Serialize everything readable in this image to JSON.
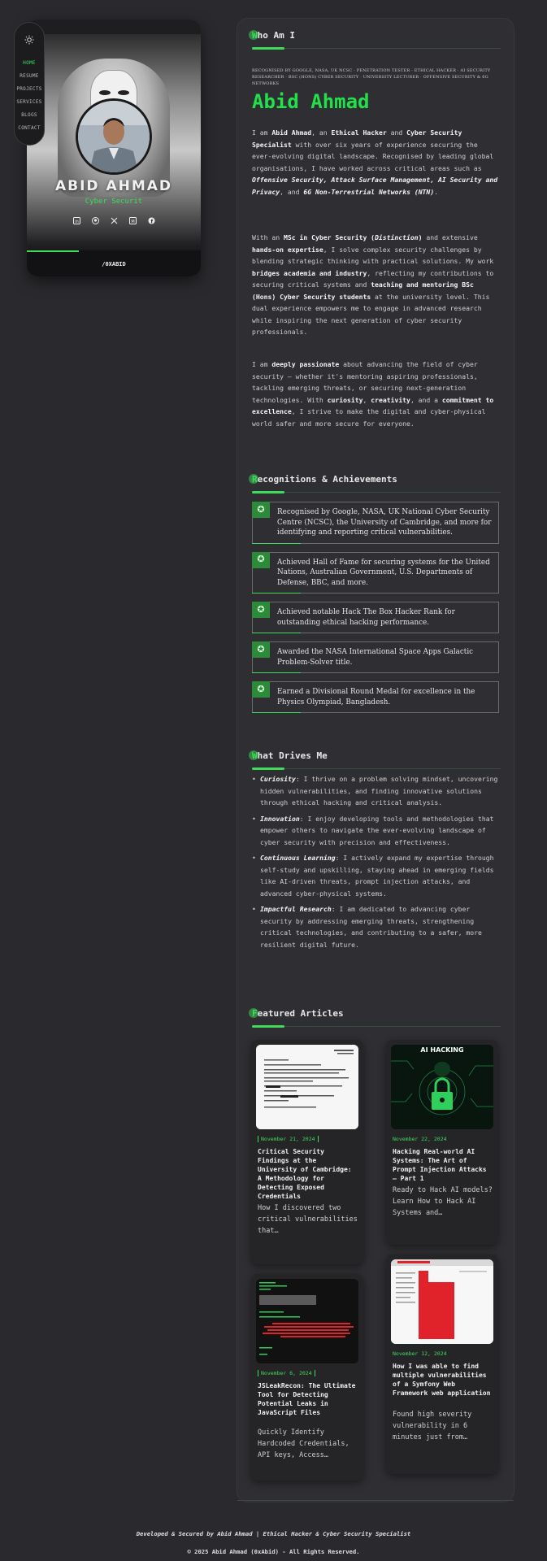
{
  "nav": {
    "theme_icon": "sun-icon",
    "items": [
      {
        "label": "HOME"
      },
      {
        "label": "RESUME"
      },
      {
        "label": "PROJECTS"
      },
      {
        "label": "SERVICES"
      },
      {
        "label": "BLOGS"
      },
      {
        "label": "CONTACT"
      }
    ]
  },
  "profile": {
    "name": "ABID AHMAD",
    "role": "Cyber Securit",
    "handle": "/0XABID",
    "social_icons": [
      "linkedin-icon",
      "github-icon",
      "x-icon",
      "medium-icon",
      "facebook-icon"
    ]
  },
  "about": {
    "section_title_first": "W",
    "section_title_rest": "ho Am I",
    "breadcrumb": "RECOGNISED BY GOOGLE, NASA, UK NCSC · PENETRATION TESTER · ETHICAL HACKER · AI SECURITY RESEARCHER · BSC (HONS) CYBER SECURITY · UNIVERSITY LECTURER · OFFENSIVE SECURITY & 6G NETWORKS",
    "name": "Abid Ahmad",
    "p1": {
      "t1": "I am ",
      "b1": "Abid Ahmad",
      "t2": ", an ",
      "b2": "Ethical Hacker",
      "t3": " and ",
      "b3": "Cyber Security Specialist",
      "t4": " with over six years of experience securing the ever-evolving digital landscape. Recognised by leading global organisations, I have worked across critical areas such as ",
      "i1": "Offensive Security, Attack Surface Management, AI Security and Privacy",
      "t5": ", and ",
      "i2": "6G Non-Terrestrial Networks (NTN)",
      "t6": "."
    },
    "p2": {
      "t1": "With an ",
      "b1": "MSc in Cyber Security (",
      "i1": "Distinction",
      "b1b": ")",
      "t2": " and extensive ",
      "b2": "hands-on expertise",
      "t3": ", I solve complex security challenges by blending strategic thinking with practical solutions. My work ",
      "b3": "bridges academia and industry",
      "t4": ", reflecting my contributions to securing critical systems and ",
      "b4": "teaching and mentoring BSc (Hons) Cyber Security students",
      "t5": " at the university level. This dual experience empowers me to engage in advanced research while inspiring the next generation of cyber security professionals."
    },
    "p3": {
      "t1": "I am ",
      "b1": "deeply passionate",
      "t2": " about advancing the field of cyber security — whether it's mentoring aspiring professionals, tackling emerging threats, or securing next-generation technologies. With ",
      "b2": "curiosity",
      "t3": ", ",
      "b3": "creativity",
      "t4": ", and a ",
      "b4": "commitment to excellence",
      "t5": ", I strive to make the digital and cyber-physical world safer and more secure for everyone."
    }
  },
  "recognitions": {
    "section_title_first": "R",
    "section_title_rest": "ecognitions & Achievements",
    "badge_icon": "award-icon",
    "items": [
      {
        "text": "Recognised by Google, NASA, UK National Cyber Security Centre (NCSC), the University of Cambridge, and more for identifying and reporting critical vulnerabilities."
      },
      {
        "text": "Achieved Hall of Fame for securing systems for the United Nations, Australian Government, U.S. Departments of Defense, BBC, and more."
      },
      {
        "text": "Achieved notable Hack The Box Hacker Rank for outstanding ethical hacking performance."
      },
      {
        "text": "Awarded the NASA International Space Apps Galactic Problem-Solver title."
      },
      {
        "text": "Earned a Divisional Round Medal for excellence in the Physics Olympiad, Bangladesh."
      }
    ]
  },
  "drives": {
    "section_title_first": "W",
    "section_title_rest": "hat Drives Me",
    "items": [
      {
        "label": "Curiosity",
        "text": ": I thrive on a problem solving mindset, uncovering hidden vulnerabilities, and finding innovative solutions through ethical hacking and critical analysis."
      },
      {
        "label": "Innovation",
        "text": ": I enjoy developing tools and methodologies that empower others to navigate the ever-evolving landscape of cyber security with precision and effectiveness."
      },
      {
        "label": "Continuous Learning",
        "text": ": I actively expand my expertise through self-study and upskilling, staying ahead in emerging fields like AI-driven threats, prompt injection attacks, and advanced cyber-physical systems."
      },
      {
        "label": "Impactful Research",
        "text": ": I am dedicated to advancing cyber security by addressing emerging threats, strengthening critical technologies, and contributing to a safer, more resilient digital future."
      }
    ]
  },
  "articles": {
    "section_title_first": "F",
    "section_title_rest": "eatured Articles",
    "items": [
      {
        "date": "November 21, 2024",
        "title": "Critical Security Findings at the University of Cambridge: A Methodology for Detecting Exposed Credentials",
        "desc": "How I discovered two critical vulnerabilities that…"
      },
      {
        "date": "November 22, 2024",
        "title": "Hacking Real-world AI Systems: The Art of Prompt Injection Attacks — Part 1",
        "desc": "Ready to Hack AI models? Learn How to Hack AI Systems and…",
        "image_caption": "AI HACKING"
      },
      {
        "date": "November 6, 2024",
        "title": "JSLeakRecon: The Ultimate Tool for Detecting Potential Leaks in JavaScript Files",
        "desc": "Quickly Identify Hardcoded Credentials, API keys, Access…"
      },
      {
        "date": "November 12, 2024",
        "title": "How I was able to find multiple vulnerabilities of a Symfony Web Framework web application",
        "desc": "Found high severity vulnerability in 6 minutes just from…"
      }
    ]
  },
  "footer": {
    "line1": "Developed & Secured by Abid Ahmad | Ethical Hacker & Cyber Security Specialist",
    "line2": "© 2025 Abid Ahmad (0xAbid) - All Rights Reserved."
  },
  "colors": {
    "accent": "#3fdc5a",
    "background": "#2a2a2e",
    "panel": "#2f2f33"
  }
}
